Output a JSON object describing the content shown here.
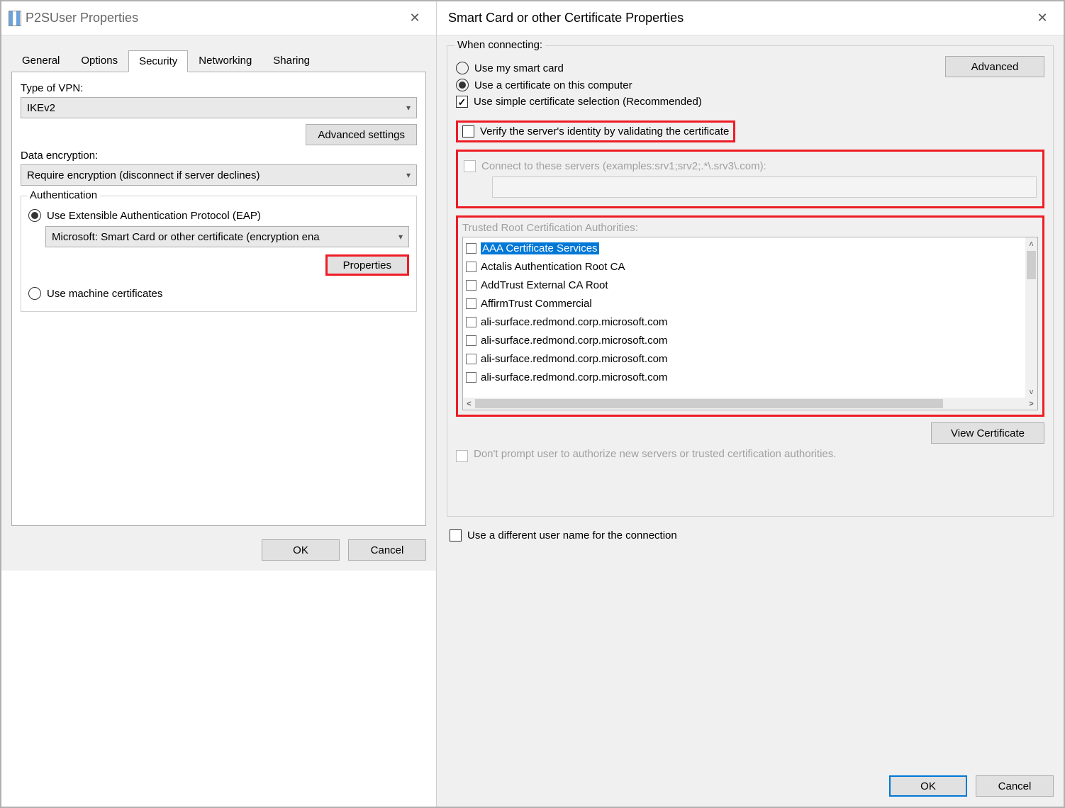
{
  "leftDialog": {
    "title": "P2SUser Properties",
    "tabs": [
      "General",
      "Options",
      "Security",
      "Networking",
      "Sharing"
    ],
    "activeTab": "Security",
    "vpnTypeLabel": "Type of VPN:",
    "vpnTypeValue": "IKEv2",
    "advancedSettings": "Advanced settings",
    "dataEncLabel": "Data encryption:",
    "dataEncValue": "Require encryption (disconnect if server declines)",
    "authLegend": "Authentication",
    "eapRadio": "Use Extensible Authentication Protocol (EAP)",
    "eapMethod": "Microsoft: Smart Card or other certificate (encryption ena",
    "propertiesBtn": "Properties",
    "machineCertRadio": "Use machine certificates",
    "ok": "OK",
    "cancel": "Cancel"
  },
  "rightDialog": {
    "title": "Smart Card or other Certificate Properties",
    "whenConnecting": "When connecting:",
    "useSmartCard": "Use my smart card",
    "useCertComputer": "Use a certificate on this computer",
    "simpleCert": "Use simple certificate selection (Recommended)",
    "advanced": "Advanced",
    "verifyServer": "Verify the server's identity by validating the certificate",
    "connectServers": "Connect to these servers (examples:srv1;srv2;.*\\.srv3\\.com):",
    "trustedRootLabel": "Trusted Root Certification Authorities:",
    "trustedRoots": [
      "AAA Certificate Services",
      "Actalis Authentication Root CA",
      "AddTrust External CA Root",
      "AffirmTrust Commercial",
      "ali-surface.redmond.corp.microsoft.com",
      "ali-surface.redmond.corp.microsoft.com",
      "ali-surface.redmond.corp.microsoft.com",
      "ali-surface.redmond.corp.microsoft.com"
    ],
    "viewCert": "View Certificate",
    "dontPrompt": "Don't prompt user to authorize new servers or trusted certification authorities.",
    "diffUserName": "Use a different user name for the connection",
    "ok": "OK",
    "cancel": "Cancel"
  }
}
